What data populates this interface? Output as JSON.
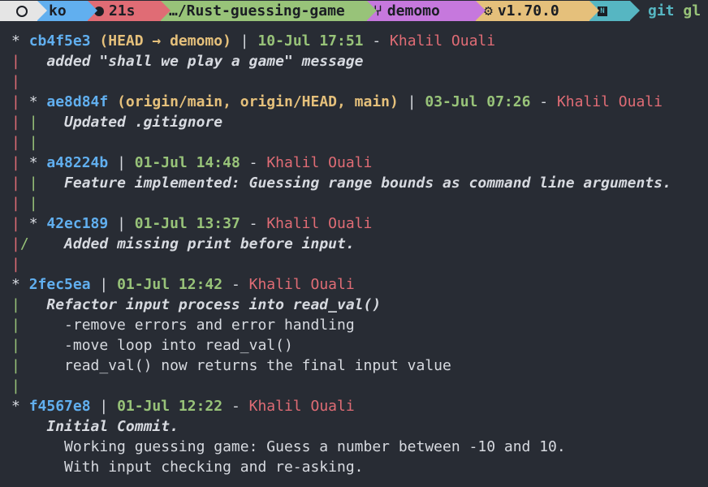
{
  "prompt": {
    "user": "ko",
    "duration": "21s",
    "directory": "…/Rust-guessing-game",
    "branch": "demomo",
    "rust_version": "v1.70.0",
    "command_git": "git",
    "command_arg": "gl"
  },
  "commits": [
    {
      "hash": "cb4f5e3",
      "refs": "(HEAD → demomo)",
      "date": "10-Jul 17:51",
      "author": "Khalil Ouali",
      "subject": "added \"shall we play a game\" message",
      "body": []
    },
    {
      "hash": "ae8d84f",
      "refs": "(origin/main, origin/HEAD, main)",
      "date": "03-Jul 07:26",
      "author": "Khalil Ouali",
      "subject": "Updated .gitignore",
      "body": []
    },
    {
      "hash": "a48224b",
      "refs": "",
      "date": "01-Jul 14:48",
      "author": "Khalil Ouali",
      "subject": "Feature implemented: Guessing range bounds as command line arguments.",
      "body": []
    },
    {
      "hash": "42ec189",
      "refs": "",
      "date": "01-Jul 13:37",
      "author": "Khalil Ouali",
      "subject": "Added missing print before input.",
      "body": []
    },
    {
      "hash": "2fec5ea",
      "refs": "",
      "date": "01-Jul 12:42",
      "author": "Khalil Ouali",
      "subject": "Refactor input process into read_val()",
      "body": [
        "-remove errors and error handling",
        "-move loop into read_val()",
        "read_val() now returns the final input value"
      ]
    },
    {
      "hash": "f4567e8",
      "refs": "",
      "date": "01-Jul 12:22",
      "author": "Khalil Ouali",
      "subject": "Initial Commit.",
      "body": [
        "Working guessing game: Guess a number between -10 and 10.",
        "With input checking and re-asking."
      ]
    }
  ],
  "colors": {
    "background": "#282c34",
    "hash": "#61afef",
    "refs": "#e5c07b",
    "date": "#98c379",
    "author": "#e06c75"
  }
}
